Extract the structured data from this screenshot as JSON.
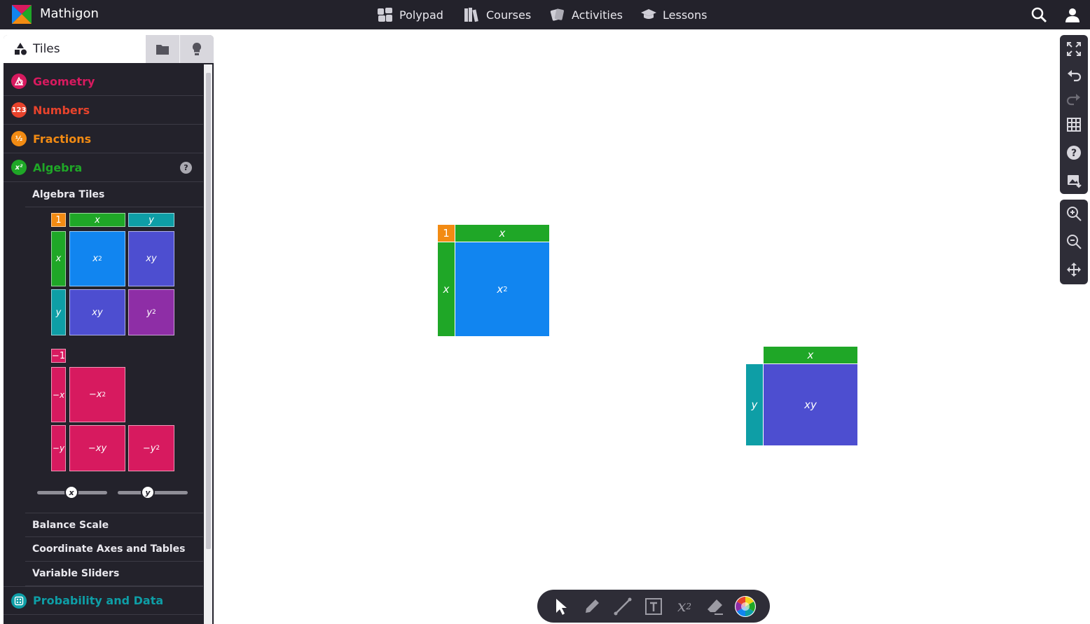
{
  "app": {
    "brand": "Mathigon"
  },
  "nav": {
    "items": [
      {
        "label": "Polypad",
        "icon": "polypad-icon"
      },
      {
        "label": "Courses",
        "icon": "books-icon"
      },
      {
        "label": "Activities",
        "icon": "cards-icon"
      },
      {
        "label": "Lessons",
        "icon": "graduation-cap-icon"
      }
    ],
    "search_icon": "search-icon",
    "account_icon": "user-icon"
  },
  "sidebar": {
    "active_tab": "Tiles",
    "categories": [
      {
        "label": "Geometry",
        "color": "#d71a5f",
        "badge": "geometry-icon"
      },
      {
        "label": "Numbers",
        "color": "#e8432c",
        "badge": "123"
      },
      {
        "label": "Fractions",
        "color": "#f28b13",
        "badge": "½"
      },
      {
        "label": "Algebra",
        "color": "#1fa727",
        "badge": "x²",
        "help": "?"
      },
      {
        "label": "Probability and Data",
        "color": "#0e9ea6",
        "badge": "dice-icon"
      }
    ],
    "algebra_sections": [
      "Algebra Tiles",
      "Balance Scale",
      "Coordinate Axes and Tables",
      "Variable Sliders"
    ],
    "tiles": {
      "one": "1",
      "neg_one": "−1",
      "x": "x",
      "y": "y",
      "x2": "x",
      "x2_exp": "2",
      "xy": "xy",
      "y2": "y",
      "y2_exp": "2",
      "neg_x": "−x",
      "neg_y": "−y",
      "neg_x2": "−x",
      "neg_x2_exp": "2",
      "neg_xy": "−xy",
      "neg_y2": "−y",
      "neg_y2_exp": "2"
    },
    "sliders": [
      {
        "label": "x"
      },
      {
        "label": "y"
      }
    ]
  },
  "canvas": {
    "group1": {
      "one": "1",
      "x_top": "x",
      "x_side": "x",
      "x2": "x",
      "x2_exp": "2"
    },
    "group2": {
      "x_top": "x",
      "y_side": "y",
      "xy": "xy"
    }
  },
  "colors": {
    "one": "#f28b13",
    "x": "#1fa727",
    "y": "#0e9ea6",
    "x2": "#1185f0",
    "xy": "#4d4ed0",
    "y2": "#8e2ea6",
    "negative": "#d71a5f"
  },
  "right_toolbar": [
    "fullscreen-icon",
    "undo-icon",
    "redo-icon",
    "grid-icon",
    "help-icon",
    "export-image-icon",
    "zoom-in-icon",
    "zoom-out-icon",
    "pan-icon"
  ],
  "bottom_toolbar": {
    "tools": [
      "select-arrow-icon",
      "pen-icon",
      "line-icon",
      "text-box-icon",
      "equation-icon",
      "eraser-icon",
      "color-wheel-icon"
    ],
    "equation_label": "x",
    "equation_exp": "2"
  }
}
